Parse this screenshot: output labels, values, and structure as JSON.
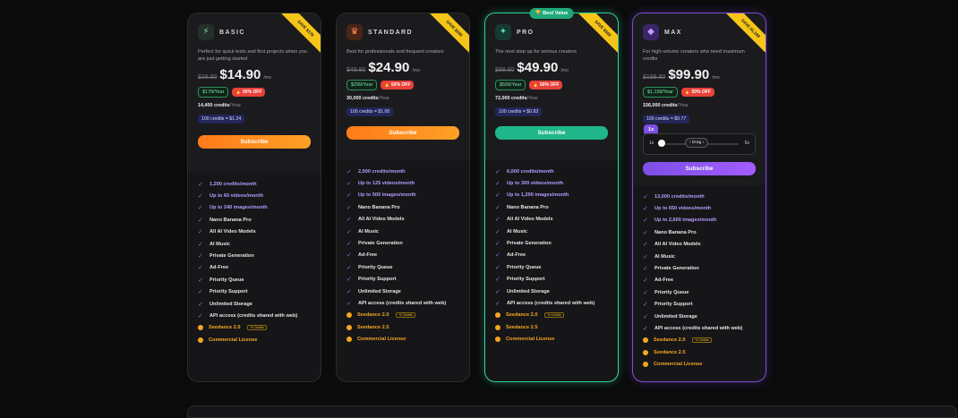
{
  "plans": [
    {
      "key": "basic",
      "name": "BASIC",
      "ribbon": "SAVE $179",
      "description": "Perfect for quick tests and first projects when you are just getting started",
      "old_price": "$29.90",
      "price": "$14.90",
      "per": "/mo",
      "yearly": "$179/Year",
      "discount": "50% OFF",
      "credits_year": "14,400 credits",
      "credits_year_unit": "/Year",
      "rate": "100 credits = $1.24",
      "subscribe": "Subscribe",
      "features": [
        "1,200 credits/month",
        "Up to 60 videos/month",
        "Up to 240 images/month",
        "Nano Banana Pro",
        "All AI Video Models",
        "AI Music",
        "Private Generation",
        "Ad-Free",
        "Priority Queue",
        "Priority Support",
        "Unlimited Storage",
        "API access (credits shared with web)",
        "Seedance 2.0",
        "Commercial License"
      ],
      "seedance_tag": "½ Credits"
    },
    {
      "key": "standard",
      "name": "STANDARD",
      "ribbon": "SAVE $299",
      "description": "Best for professionals and frequent creators",
      "old_price": "$49.80",
      "price": "$24.90",
      "per": "/mo",
      "yearly": "$299/Year",
      "discount": "50% OFF",
      "credits_year": "30,000 credits",
      "credits_year_unit": "/Year",
      "rate": "100 credits = $1.00",
      "subscribe": "Subscribe",
      "features": [
        "2,500 credits/month",
        "Up to 125 videos/month",
        "Up to 500 images/month",
        "Nano Banana Pro",
        "All AI Video Models",
        "AI Music",
        "Private Generation",
        "Ad-Free",
        "Priority Queue",
        "Priority Support",
        "Unlimited Storage",
        "API access (credits shared with web)",
        "Seedance 2.0",
        "Seedance 2.5",
        "Commercial License"
      ],
      "seedance_tag": "½ Credits"
    },
    {
      "key": "pro",
      "name": "PRO",
      "ribbon": "SAVE $599",
      "best_value": "Best Value",
      "description": "The next step up for serious creators",
      "old_price": "$99.80",
      "price": "$49.90",
      "per": "/mo",
      "yearly": "$599/Year",
      "discount": "50% OFF",
      "credits_year": "72,000 credits",
      "credits_year_unit": "/Year",
      "rate": "100 credits = $0.83",
      "subscribe": "Subscribe",
      "features": [
        "6,000 credits/month",
        "Up to 300 videos/month",
        "Up to 1,200 images/month",
        "Nano Banana Pro",
        "All AI Video Models",
        "AI Music",
        "Private Generation",
        "Ad-Free",
        "Priority Queue",
        "Priority Support",
        "Unlimited Storage",
        "API access (credits shared with web)",
        "Seedance 2.0",
        "Seedance 2.5",
        "Commercial License"
      ],
      "seedance_tag": "½ Credits"
    },
    {
      "key": "max",
      "name": "MAX",
      "ribbon": "SAVE $1,199",
      "description": "For high-volume creators who need maximum credits",
      "old_price": "$199.80",
      "price": "$99.90",
      "per": "/mo",
      "yearly": "$1,199/Year",
      "discount": "50% OFF",
      "credits_year": "156,000 credits",
      "credits_year_unit": "/Year",
      "rate": "100 credits = $0.77",
      "subscribe": "Subscribe",
      "slider": {
        "tooltip": "1x",
        "min": "1x",
        "max": "5x",
        "drag": "‹ Drag ›",
        "level_fraction": 0
      },
      "features": [
        "13,000 credits/month",
        "Up to 650 videos/month",
        "Up to 2,600 images/month",
        "Nano Banana Pro",
        "All AI Video Models",
        "AI Music",
        "Private Generation",
        "Ad-Free",
        "Priority Queue",
        "Priority Support",
        "Unlimited Storage",
        "API access (credits shared with web)",
        "Seedance 2.0",
        "Seedance 2.5",
        "Commercial License"
      ],
      "seedance_tag": "½ Credits"
    }
  ],
  "colors": {
    "basic_icon": "#2b3a2e",
    "standard_icon": "#4a2418",
    "pro_icon": "#173a30",
    "max_icon": "#3a2566"
  },
  "icons": {
    "basic": "lightning-icon",
    "standard": "crown-icon",
    "pro": "sparkle-icon",
    "max": "diamond-icon",
    "check": "check-icon",
    "coin": "coin-icon"
  }
}
